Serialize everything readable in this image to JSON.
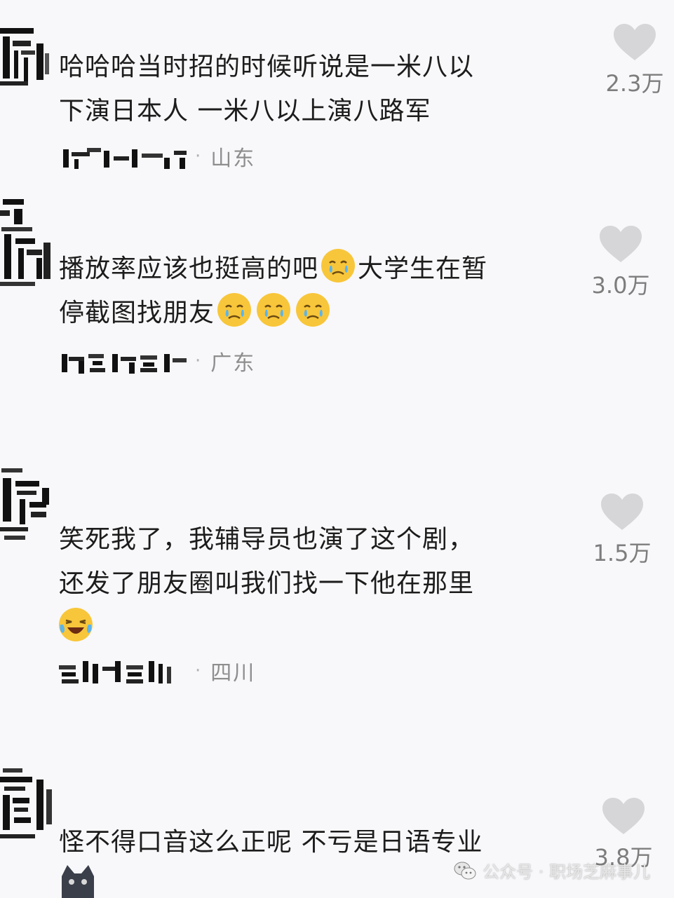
{
  "comments": [
    {
      "text": "哈哈哈当时招的时候听说是一米八以\n下演日本人 一米八以上演八路军",
      "region": "山东",
      "likes": "2.3万"
    },
    {
      "text_part1": "播放率应该也挺高的吧",
      "text_part2": "大学生在暂\n停截图找朋友",
      "region": "广东",
      "likes": "3.0万"
    },
    {
      "text": "笑死我了，我辅导员也演了这个剧，\n还发了朋友圈叫我们找一下他在那里",
      "region": "四川",
      "likes": "1.5万"
    },
    {
      "text": "怪不得口音这么正呢 不亏是日语专业",
      "likes": "3.8万"
    }
  ],
  "watermark": {
    "text": "公众号 · 职场芝麻事儿"
  },
  "icons": {
    "like": "heart-icon",
    "cry_emoji": "crying-face-icon",
    "laugh_emoji": "laughing-tears-icon",
    "watermark": "wechat-icon"
  },
  "colors": {
    "background": "#f8f8fa",
    "text": "#1c1c1c",
    "meta": "#8e8e8e",
    "heart": "#d6d6d8"
  }
}
